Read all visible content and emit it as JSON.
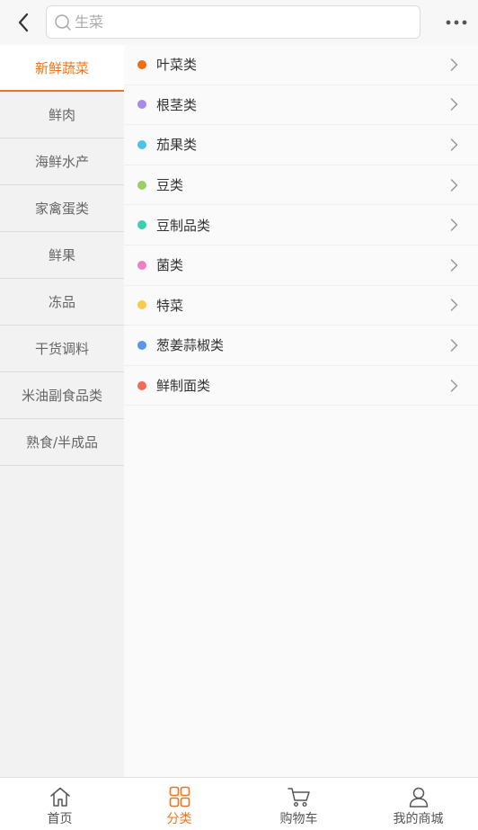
{
  "header": {
    "search_placeholder": "生菜"
  },
  "sidebar": {
    "items": [
      {
        "label": "新鲜蔬菜",
        "active": true
      },
      {
        "label": "鲜肉"
      },
      {
        "label": "海鲜水产"
      },
      {
        "label": "家禽蛋类"
      },
      {
        "label": "鲜果"
      },
      {
        "label": "冻品"
      },
      {
        "label": "干货调料"
      },
      {
        "label": "米油副食品类"
      },
      {
        "label": "熟食/半成品"
      }
    ]
  },
  "subcategories": [
    {
      "label": "叶菜类",
      "color": "#f26a12"
    },
    {
      "label": "根茎类",
      "color": "#a98ae8"
    },
    {
      "label": "茄果类",
      "color": "#4cc3e8"
    },
    {
      "label": "豆类",
      "color": "#9bd063"
    },
    {
      "label": "豆制品类",
      "color": "#3ccfae"
    },
    {
      "label": "菌类",
      "color": "#ee7fc4"
    },
    {
      "label": "特菜",
      "color": "#f7cd48"
    },
    {
      "label": "葱姜蒜椒类",
      "color": "#5a96ea"
    },
    {
      "label": "鲜制面类",
      "color": "#f36a5a"
    }
  ],
  "tabbar": {
    "items": [
      {
        "label": "首页",
        "icon": "home-icon"
      },
      {
        "label": "分类",
        "icon": "category-icon",
        "active": true
      },
      {
        "label": "购物车",
        "icon": "cart-icon"
      },
      {
        "label": "我的商城",
        "icon": "user-icon"
      }
    ]
  },
  "colors": {
    "accent": "#f0731b"
  }
}
